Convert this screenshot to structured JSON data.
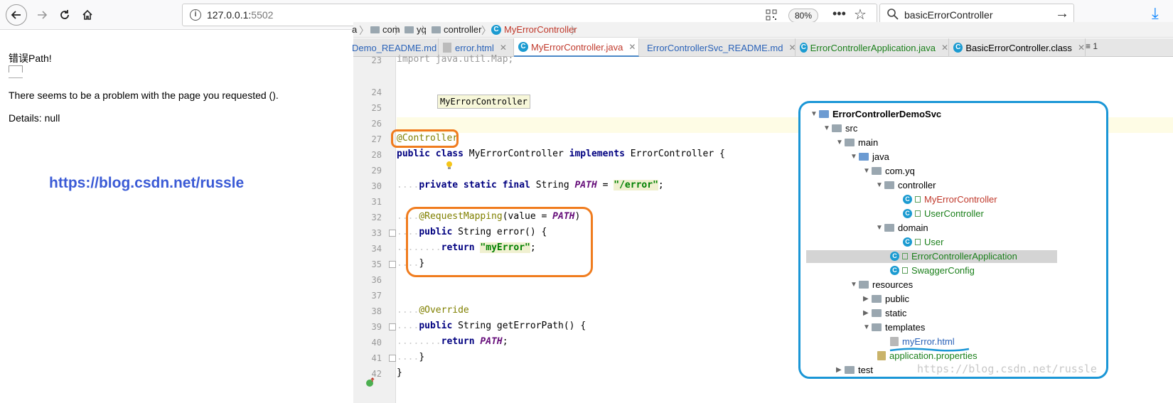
{
  "browser": {
    "url_host": "127.0.0.1:",
    "url_port": "5502",
    "zoom": "80%",
    "search_query": "basicErrorController"
  },
  "webpage": {
    "title": "错误Path!",
    "message": "There seems to be a problem with the page you requested ().",
    "details": "Details: null",
    "blog_link": "https://blog.csdn.net/russle"
  },
  "ide": {
    "breadcrumb": [
      "a",
      "com",
      "yq",
      "controller",
      "MyErrorController"
    ],
    "tabs": [
      {
        "label": "Demo_README.md",
        "active": false
      },
      {
        "label": "error.html",
        "active": false
      },
      {
        "label": "MyErrorController.java",
        "active": true
      },
      {
        "label": "ErrorControllerSvc_README.md",
        "active": false
      },
      {
        "label": "ErrorControllerApplication.java",
        "active": false
      },
      {
        "label": "BasicErrorController.class",
        "active": false
      }
    ],
    "tab_overflow": "≡ 1",
    "tooltip": "MyErrorController",
    "line_numbers": [
      "23",
      "24",
      "25",
      "26",
      "27",
      "28",
      "29",
      "30",
      "31",
      "32",
      "33",
      "34",
      "35",
      "36",
      "37",
      "38",
      "39",
      "40",
      "41",
      "42"
    ],
    "code": {
      "l23": "import java.util.Map;",
      "l27_ann": "@Controller",
      "l28_kw1": "public",
      "l28_kw2": "class",
      "l28_name": "MyErrorController",
      "l28_kw3": "implements",
      "l28_rest": "ErrorController {",
      "l30_kw": "private static final",
      "l30_type": "String",
      "l30_const": "PATH",
      "l30_eq": "=",
      "l30_str": "\"/error\"",
      "l30_end": ";",
      "l32_ann": "@RequestMapping",
      "l32_args_open": "(value =",
      "l32_const": "PATH",
      "l32_args_close": ")",
      "l33_kw": "public",
      "l33_rest": "String error()",
      "l33_brace": "{",
      "l34_kw": "return",
      "l34_str": "\"myError\"",
      "l34_end": ";",
      "l35": "}",
      "l38_ann": "@Override",
      "l39_kw": "public",
      "l39_rest": "String getErrorPath()",
      "l39_brace": "{",
      "l40_kw": "return",
      "l40_const": "PATH",
      "l40_end": ";",
      "l41": "}",
      "l42": "}"
    },
    "project_tree": [
      {
        "label": "ErrorControllerDemoSvc"
      },
      {
        "label": "src"
      },
      {
        "label": "main"
      },
      {
        "label": "java"
      },
      {
        "label": "com.yq"
      },
      {
        "label": "controller"
      },
      {
        "label": "MyErrorController"
      },
      {
        "label": "UserController"
      },
      {
        "label": "domain"
      },
      {
        "label": "User"
      },
      {
        "label": "ErrorControllerApplication"
      },
      {
        "label": "SwaggerConfig"
      },
      {
        "label": "resources"
      },
      {
        "label": "public"
      },
      {
        "label": "static"
      },
      {
        "label": "templates"
      },
      {
        "label": "myError.html"
      },
      {
        "label": "application.properties"
      },
      {
        "label": "test"
      }
    ],
    "watermark": "https://blog.csdn.net/russle"
  },
  "colors": {
    "annotation_circle": "#f07c1e",
    "tree_border": "#1a96d6",
    "link_blue": "#3b5bd6"
  }
}
